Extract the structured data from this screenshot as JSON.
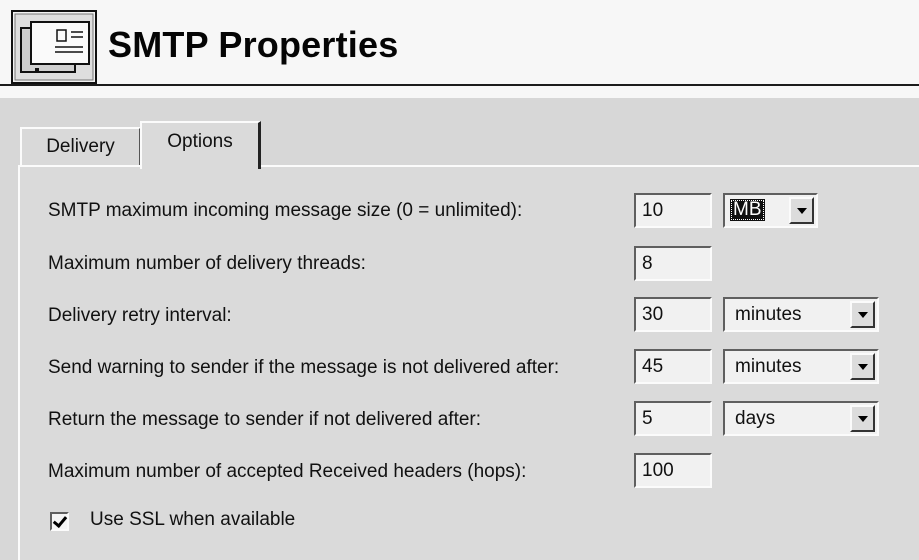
{
  "window": {
    "title": "SMTP Properties",
    "icon": "mail-server-icon"
  },
  "tabs": [
    {
      "label": "Delivery",
      "active": false
    },
    {
      "label": "Options",
      "active": true
    }
  ],
  "options": {
    "max_message_size": {
      "label": "SMTP maximum incoming message size (0 = unlimited):",
      "value": "10",
      "unit": "MB"
    },
    "delivery_threads": {
      "label": "Maximum number of delivery threads:",
      "value": "8"
    },
    "retry_interval": {
      "label": "Delivery retry interval:",
      "value": "30",
      "unit": "minutes"
    },
    "warning_after": {
      "label": "Send warning to sender if the message is not delivered after:",
      "value": "45",
      "unit": "minutes"
    },
    "return_after": {
      "label": "Return the message to sender if not delivered after:",
      "value": "5",
      "unit": "days"
    },
    "max_received_headers": {
      "label": "Maximum number of accepted Received headers (hops):",
      "value": "100"
    },
    "use_ssl": {
      "label": "Use SSL when available",
      "checked": true
    }
  }
}
